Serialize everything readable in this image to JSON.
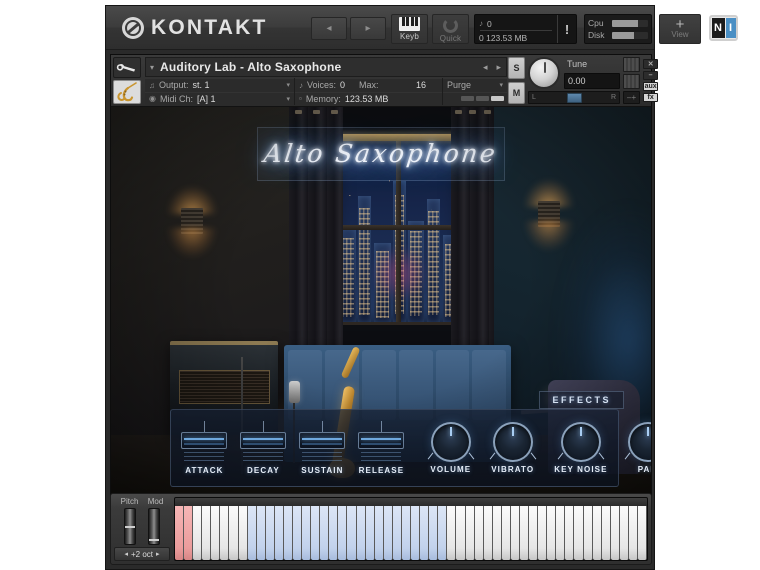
{
  "app": {
    "name": "KONTAKT",
    "logo_icon": "ni-circle-logo"
  },
  "toolbar": {
    "back_label": "◂",
    "forward_label": "▸",
    "keyb_label": "Keyb",
    "quick_label": "Quick",
    "memory": {
      "voices_icon": "note-icon",
      "voices_value": "0",
      "memory_icon": "memory-icon",
      "memory_value": "0  123.53 MB",
      "alert_label": "!"
    },
    "cpu_label": "Cpu",
    "disk_label": "Disk",
    "view_plus": "+",
    "view_label": "View",
    "ni_badge_n": "N",
    "ni_badge_i": "I"
  },
  "instrument": {
    "wrench_icon": "wrench-icon",
    "sax_icon": "saxophone-icon",
    "chevron": "▾",
    "name": "Auditory Lab - Alto Saxophone",
    "prev_arrow": "◂",
    "next_arrow": "▸",
    "output_icon": "output-icon",
    "output_label": "Output:",
    "output_value": "st. 1",
    "midi_icon": "midi-icon",
    "midi_label": "Midi Ch:",
    "midi_value": "[A] 1",
    "voices_icon": "voices-icon",
    "voices_label": "Voices:",
    "voices_value": "0",
    "max_label": "Max:",
    "max_value": "16",
    "memory_icon": "memory-icon",
    "memory_label": "Memory:",
    "memory_value": "123.53 MB",
    "purge_label": "Purge",
    "dropdown_arrow": "▾",
    "solo_label": "S",
    "mute_label": "M",
    "tune_label": "Tune",
    "tune_value": "0.00",
    "pan_left": "L",
    "pan_right": "R",
    "vol_minus": "–",
    "vol_plus": "+",
    "close_label": "✕",
    "minimize_label": "–",
    "aux_label": "aux",
    "fx_label": "fx"
  },
  "gui": {
    "neon_title": "Alto Saxophone",
    "effects_tab": "EFFECTS",
    "sliders": [
      {
        "label": "ATTACK"
      },
      {
        "label": "DECAY"
      },
      {
        "label": "SUSTAIN"
      },
      {
        "label": "RELEASE"
      }
    ],
    "knobs": [
      {
        "label": "VOLUME"
      },
      {
        "label": "VIBRATO"
      },
      {
        "label": "KEY NOISE"
      },
      {
        "label": "PAN"
      }
    ],
    "colors": {
      "accent_blue": "#6fa8dd",
      "neon_white": "#f2f7ff",
      "panel_bg": "#16202f"
    }
  },
  "keyboard": {
    "pitch_label": "Pitch",
    "mod_label": "Mod",
    "octave_prev": "◂",
    "octave_value": "+2 oct",
    "octave_next": "▸",
    "key_colors": {
      "keyswitch": "#f0a8a8",
      "sampled": "#cddcf2",
      "normal": "#fbfbfb"
    }
  }
}
